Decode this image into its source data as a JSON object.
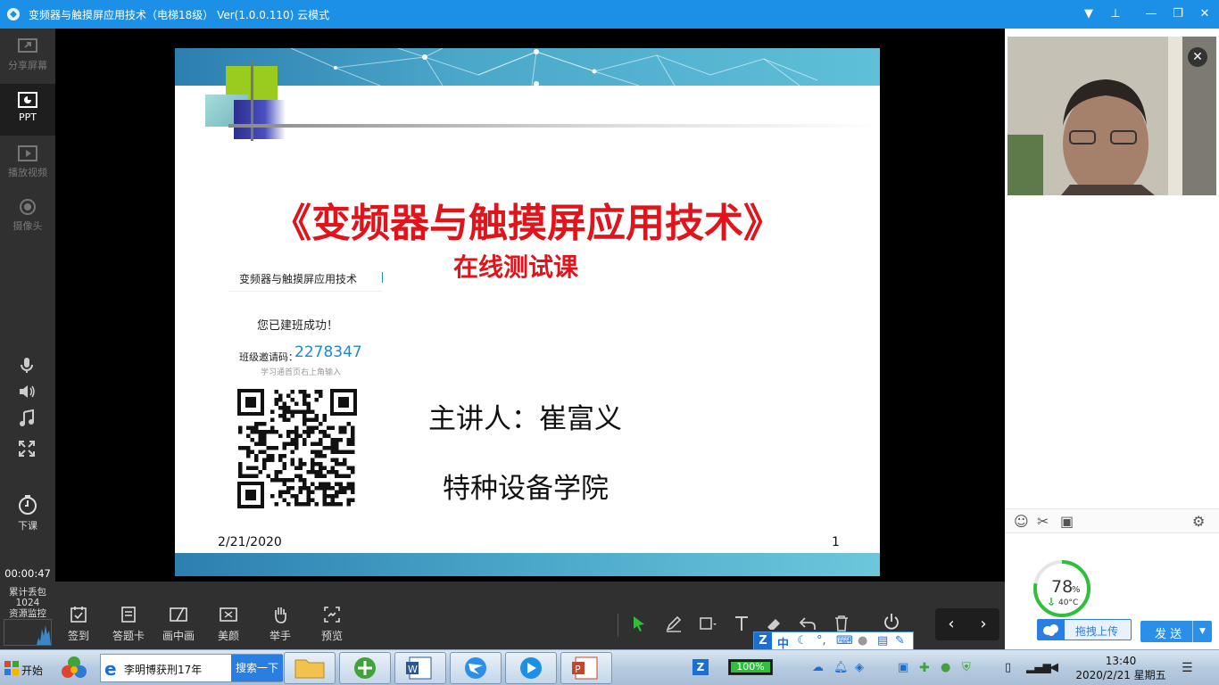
{
  "window": {
    "title": "变频器与触摸屏应用技术（电梯18级） Ver(1.0.0.110)  云模式",
    "controls": [
      "▼",
      "⊥",
      "—",
      "❐",
      "✕"
    ]
  },
  "sidebar": {
    "items": [
      {
        "label": "分享屏幕",
        "icon": "share-screen-icon"
      },
      {
        "label": "PPT",
        "icon": "ppt-icon"
      },
      {
        "label": "播放视频",
        "icon": "play-video-icon"
      },
      {
        "label": "摄像头",
        "icon": "camera-icon"
      }
    ],
    "end_class_label": "下课",
    "timer": "00:00:47",
    "stats": {
      "line1": "累计丢包",
      "line2": "1024",
      "line3": "资源监控"
    }
  },
  "slide": {
    "title": "《变频器与触摸屏应用技术》",
    "subtitle": "在线测试课",
    "course_name": "变频器与触摸屏应用技术",
    "success_text": "您已建班成功！",
    "invite_label": "班级邀请码：",
    "invite_code": "2278347",
    "invite_hint": "学习通首页右上角输入",
    "speaker": "主讲人：崔富义",
    "institute": "特种设备学院",
    "date": "2/21/2020",
    "page": "1"
  },
  "toolbar": {
    "buttons": [
      {
        "label": "签到",
        "icon": "checkin-icon"
      },
      {
        "label": "答题卡",
        "icon": "answer-card-icon"
      },
      {
        "label": "画中画",
        "icon": "picture-in-picture-icon"
      },
      {
        "label": "美颜",
        "icon": "beauty-icon"
      },
      {
        "label": "举手",
        "icon": "raise-hand-icon"
      },
      {
        "label": "预览",
        "icon": "preview-icon"
      }
    ],
    "prev": "‹",
    "next": "›"
  },
  "ime": {
    "mode": "中"
  },
  "right_panel": {
    "close": "✕",
    "temperature": {
      "percent": "78",
      "unit": "%",
      "celsius": "40°C",
      "fraction": 0.78
    },
    "upload_label": "拖拽上传",
    "send_label": "发 送",
    "send_dropdown": "▼"
  },
  "taskbar": {
    "start_label": "开始",
    "search_text": "李明博获刑17年",
    "search_button": "搜索一下",
    "battery": "100%",
    "time": "13:40",
    "date": "2020/2/21 星期五"
  },
  "colors": {
    "titlebar": "#1c8fe6",
    "slide_title": "#e0151b",
    "invite_code": "#1a8ad6",
    "accent": "#2a7de1"
  }
}
